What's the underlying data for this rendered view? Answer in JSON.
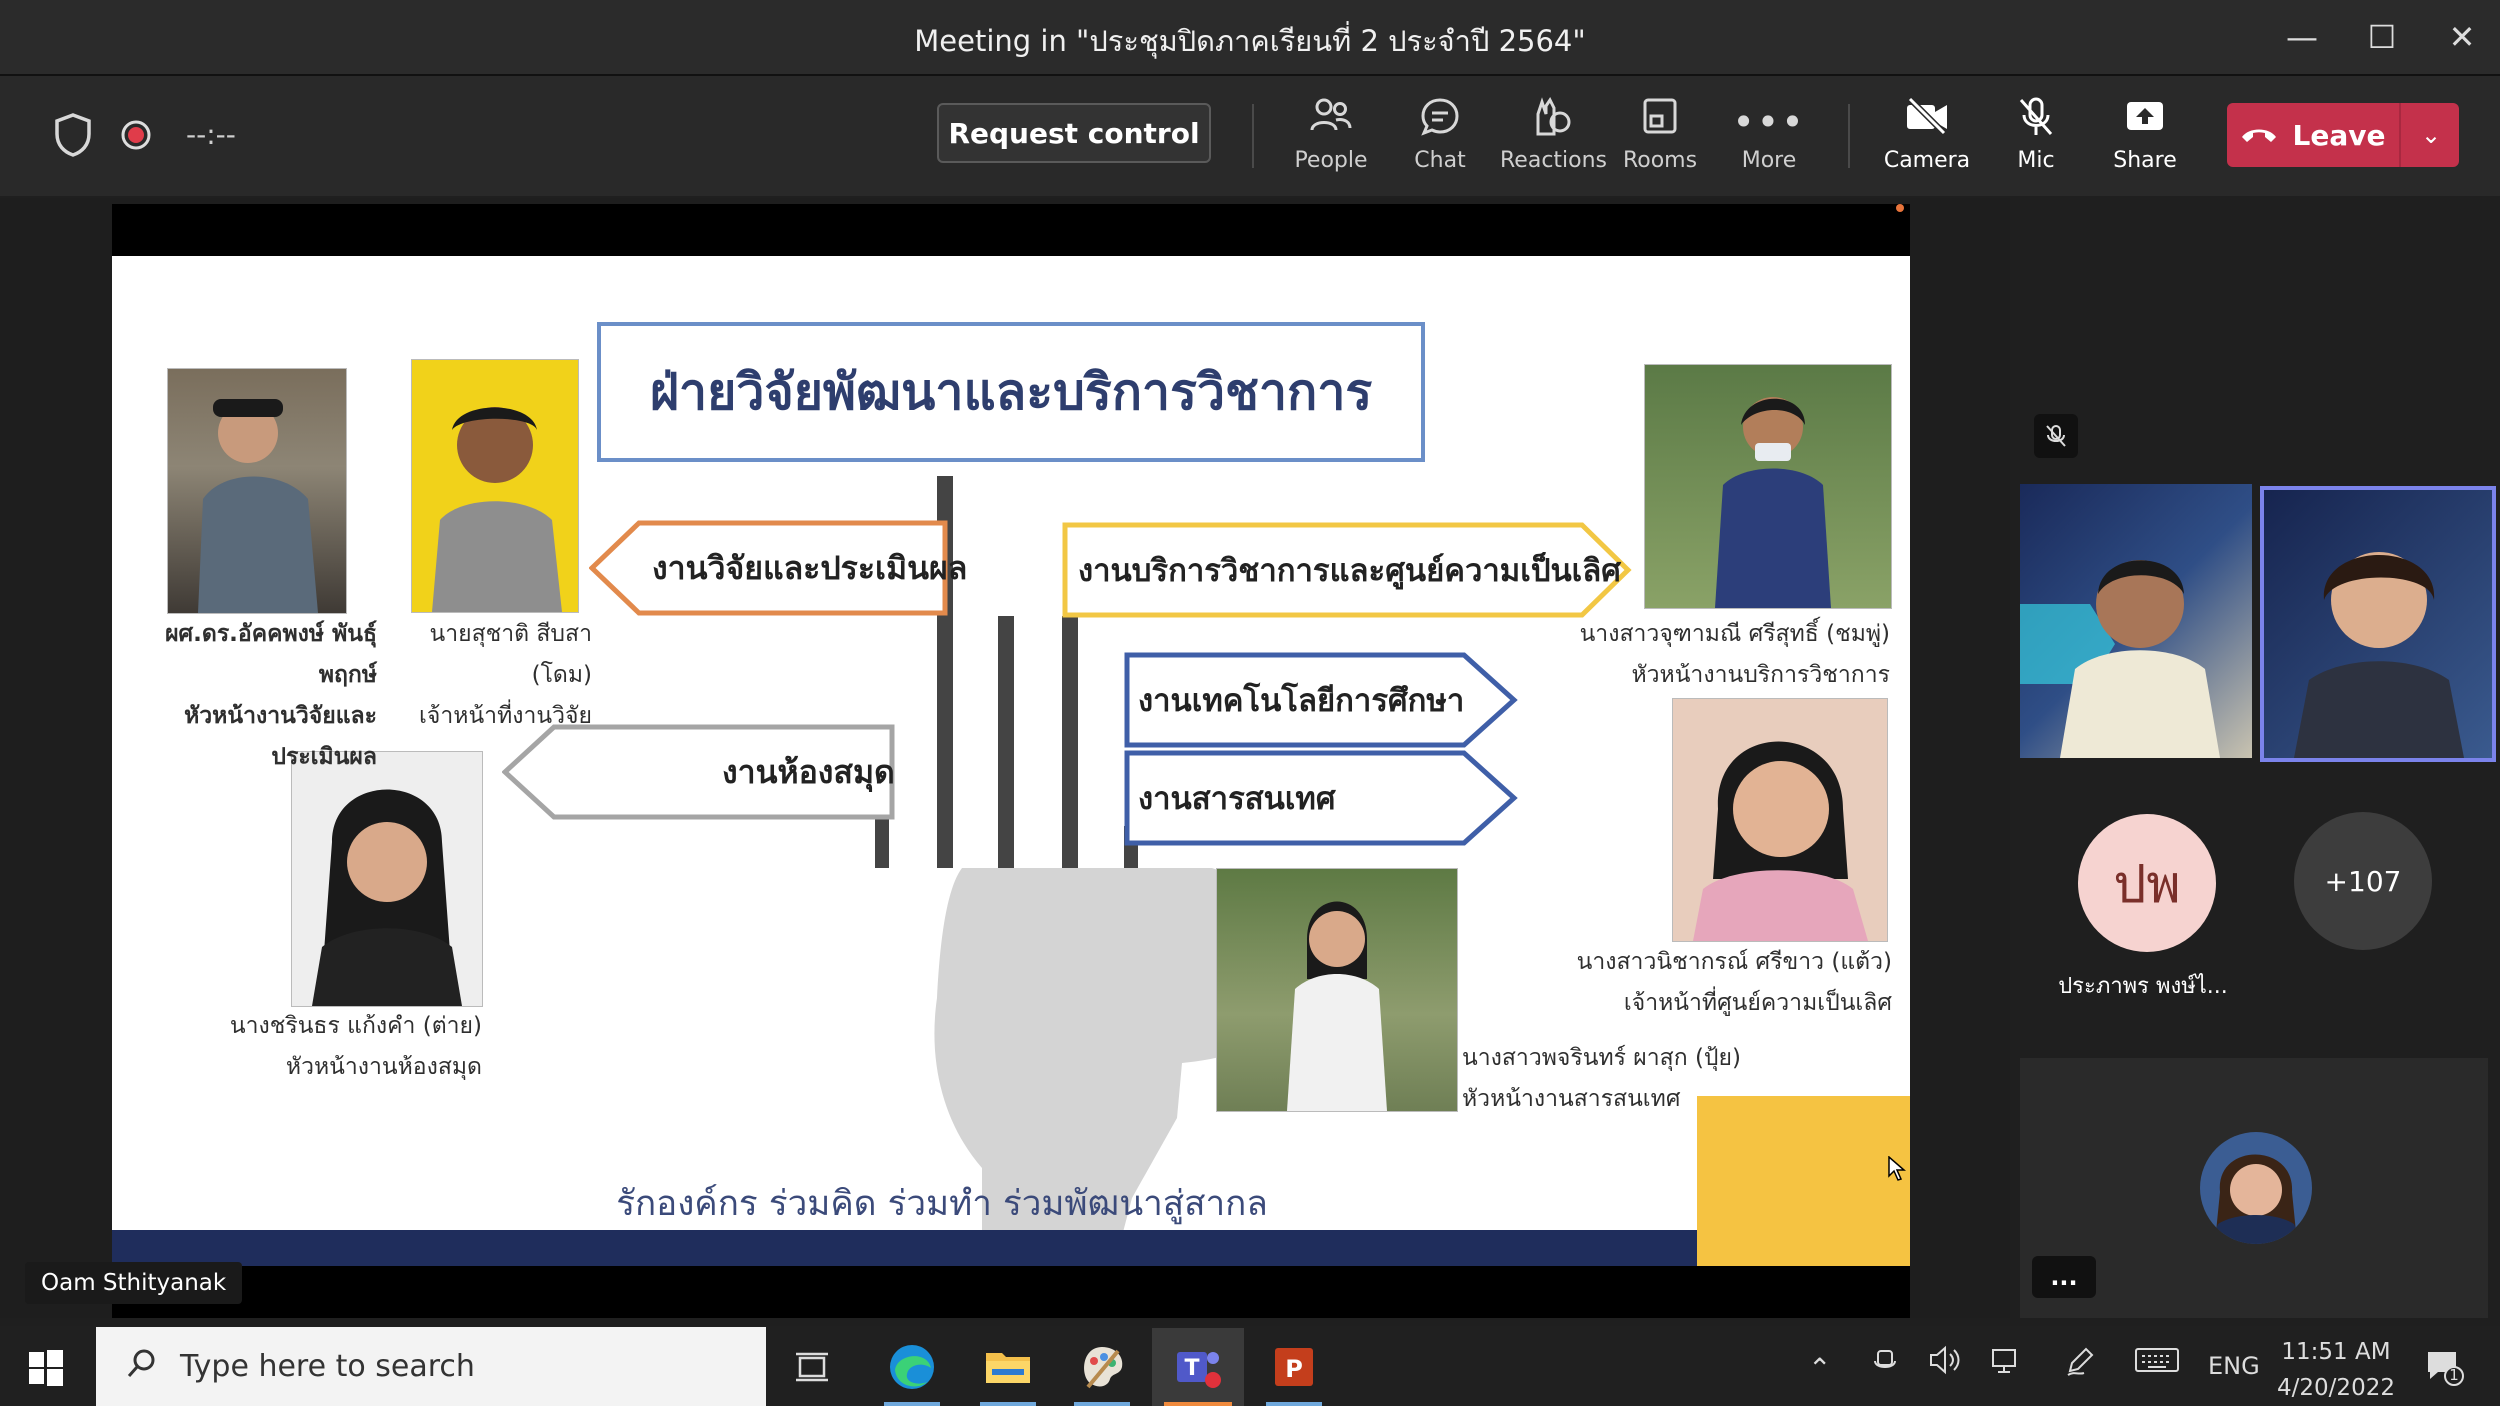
{
  "window": {
    "title": "Meeting in \"ประชุมปิดภาคเรียนที่ 2 ประจำปี 2564\"",
    "controls": [
      "minimize-icon",
      "maximize-icon",
      "close-icon"
    ]
  },
  "toolbar": {
    "timer": "--:--",
    "request_control": "Request control",
    "items": [
      {
        "label": "People",
        "icon": "people-icon"
      },
      {
        "label": "Chat",
        "icon": "chat-icon"
      },
      {
        "label": "Reactions",
        "icon": "reactions-icon"
      },
      {
        "label": "Rooms",
        "icon": "rooms-icon"
      },
      {
        "label": "More",
        "icon": "more-icon"
      },
      {
        "label": "Camera",
        "icon": "camera-off-icon"
      },
      {
        "label": "Mic",
        "icon": "mic-off-icon"
      },
      {
        "label": "Share",
        "icon": "share-icon"
      }
    ],
    "leave": "Leave",
    "colors": {
      "leave": "#c4314b",
      "record": "#e03c4a"
    }
  },
  "slide": {
    "title": "ฝ่ายวิจัยพัฒนาและบริการวิชาการ",
    "footer": "รักองค์กร ร่วมคิด ร่วมทำ ร่วมพัฒนาสู่สากล",
    "units": {
      "research": "งานวิจัยและประเมินผล",
      "academic_service": "งานบริการวิชาการและศูนย์ความเป็นเลิศ",
      "edtech": "งานเทคโนโลยีการศึกษา",
      "infosci": "งานสารสนเทศ",
      "library": "งานห้องสมุด"
    },
    "people": {
      "p1_name": "ผศ.ดร.อัคคพงษ์ พันธุ์พฤกษ์",
      "p1_role1": "หัวหน้างานวิจัยและ",
      "p1_role2": "ประเมินผล",
      "p2_name": "นายสุชาติ สีบสา (โดม)",
      "p2_role": "เจ้าหน้าที่งานวิจัย",
      "p3_name": "นางสาวจุฑามณี ศรีสุทธิ์ (ชมพู่)",
      "p3_role": "หัวหน้างานบริการวิชาการ",
      "p4_name": "นางชรินธร แก้งคำ (ต่าย)",
      "p4_role": "หัวหน้างานห้องสมุด",
      "p5_name": "นางสาวนิชากรณ์ ศรีขาว (แต้ว)",
      "p5_role": "เจ้าหน้าที่ศูนย์ความเป็นเลิศ",
      "p6_name": "นางสาวพจรินทร์ ผาสุก (ปุ้ย)",
      "p6_role": "หัวหน้างานสารสนเทศ"
    },
    "colors": {
      "title_border": "#6b8fc8",
      "research": "#e28a4c",
      "service": "#f2c744",
      "edtech": "#3f5fa8",
      "library": "#a5a5a5",
      "footer_bar": "#1f2d5c",
      "corner": "#f5c342"
    }
  },
  "presenter_name": "Oam Sthityanak",
  "panel": {
    "avatar_initials": "ปพ",
    "avatar_name": "ประภาพร พงษ์ไ...",
    "overflow_count": "+107",
    "more_dots": "..."
  },
  "taskbar": {
    "search_placeholder": "Type here to search",
    "apps": [
      "task-view-icon",
      "edge-icon",
      "file-explorer-icon",
      "paint-icon",
      "teams-icon",
      "powerpoint-icon"
    ],
    "language": "ENG",
    "time": "11:51 AM",
    "date": "4/20/2022",
    "notification_count": "1"
  }
}
